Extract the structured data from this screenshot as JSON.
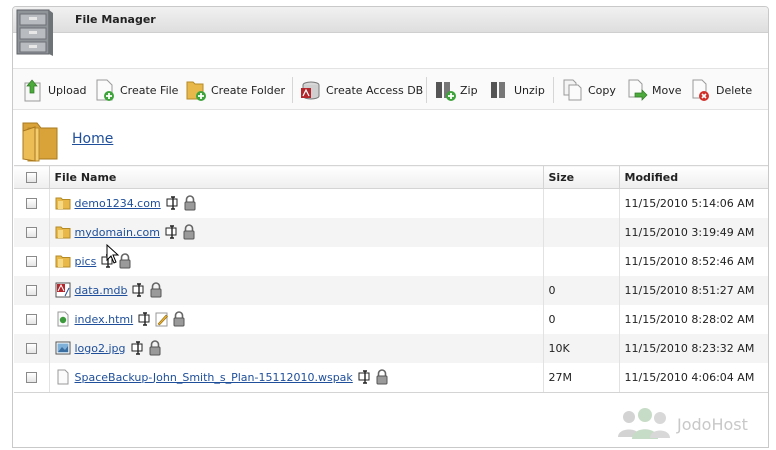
{
  "window": {
    "title": "File Manager"
  },
  "toolbar": {
    "upload": "Upload",
    "create_file": "Create File",
    "create_folder": "Create Folder",
    "create_access_db": "Create Access DB",
    "zip": "Zip",
    "unzip": "Unzip",
    "copy": "Copy",
    "move": "Move",
    "delete": "Delete"
  },
  "breadcrumb": {
    "home": "Home"
  },
  "table": {
    "headers": {
      "name": "File Name",
      "size": "Size",
      "modified": "Modified"
    },
    "rows": [
      {
        "name": "demo1234.com",
        "type": "folder-icon",
        "size": "",
        "modified": "11/15/2010 5:14:06 AM"
      },
      {
        "name": "mydomain.com",
        "type": "folder-icon",
        "size": "",
        "modified": "11/15/2010 3:19:49 AM"
      },
      {
        "name": "pics",
        "type": "folder-icon",
        "size": "",
        "modified": "11/15/2010 8:52:46 AM"
      },
      {
        "name": "data.mdb",
        "type": "access-db-icon",
        "size": "0",
        "modified": "11/15/2010 8:51:27 AM"
      },
      {
        "name": "index.html",
        "type": "html-file-icon",
        "size": "0",
        "modified": "11/15/2010 8:28:02 AM"
      },
      {
        "name": "logo2.jpg",
        "type": "image-file-icon",
        "size": "10K",
        "modified": "11/15/2010 8:23:32 AM"
      },
      {
        "name": "SpaceBackup-John_Smith_s_Plan-15112010.wspak",
        "type": "generic-file-icon",
        "size": "27M",
        "modified": "11/15/2010 4:06:04 AM"
      }
    ]
  },
  "branding": {
    "text": "JodoHost"
  },
  "colors": {
    "link": "#1f4f9a",
    "folder": "#e8b94a",
    "header_bg": "#eeeeee"
  }
}
